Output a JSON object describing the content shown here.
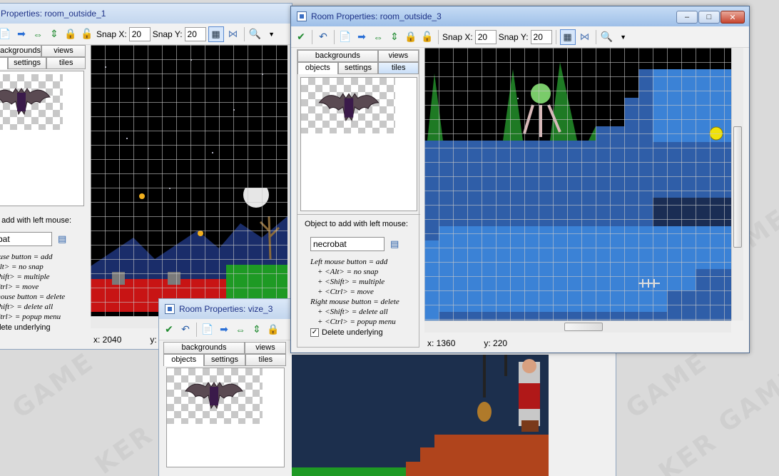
{
  "win1": {
    "title": "Properties: room_outside_1",
    "snap_x_label": "Snap X:",
    "snap_x": "20",
    "snap_y_label": "Snap Y:",
    "snap_y": "20",
    "tabs": [
      "backgrounds",
      "views",
      "settings",
      "tiles"
    ],
    "add_label": "o add with left mouse:",
    "object_value": "bat",
    "help": [
      "ouse button = add",
      "Alt> = no snap",
      "Shift> = multiple",
      "Ctrl> = move",
      "mouse button = delete",
      "Shift> = delete all",
      "Ctrl> = popup menu"
    ],
    "delete_underlying": "elete underlying",
    "x_status": "x: 2040",
    "y_status": "y: 0"
  },
  "win2": {
    "title": "Room Properties: vize_3",
    "tabs": [
      "backgrounds",
      "views",
      "objects",
      "settings",
      "tiles"
    ]
  },
  "win3": {
    "title": "Room Properties: room_outside_3",
    "snap_x_label": "Snap X:",
    "snap_x": "20",
    "snap_y_label": "Snap Y:",
    "snap_y": "20",
    "tabs": [
      "backgrounds",
      "views",
      "objects",
      "settings",
      "tiles"
    ],
    "add_label": "Object to add with left mouse:",
    "object_value": "necrobat",
    "help": [
      "Left mouse button = add",
      "+ <Alt> = no snap",
      "+ <Shift> = multiple",
      "+ <Ctrl> = move",
      "Right mouse button = delete",
      "+ <Shift> = delete all",
      "+ <Ctrl> = popup menu"
    ],
    "delete_underlying": "Delete underlying",
    "x_status": "x: 1360",
    "y_status": "y: 220",
    "minimize": "–",
    "maximize": "□",
    "close": "✕"
  },
  "colors": {
    "accent": "#3a6fc4",
    "water": "#3b82d6",
    "brick": "#2f5ea8",
    "lava": "#c81414",
    "grass": "#1e9a24"
  }
}
